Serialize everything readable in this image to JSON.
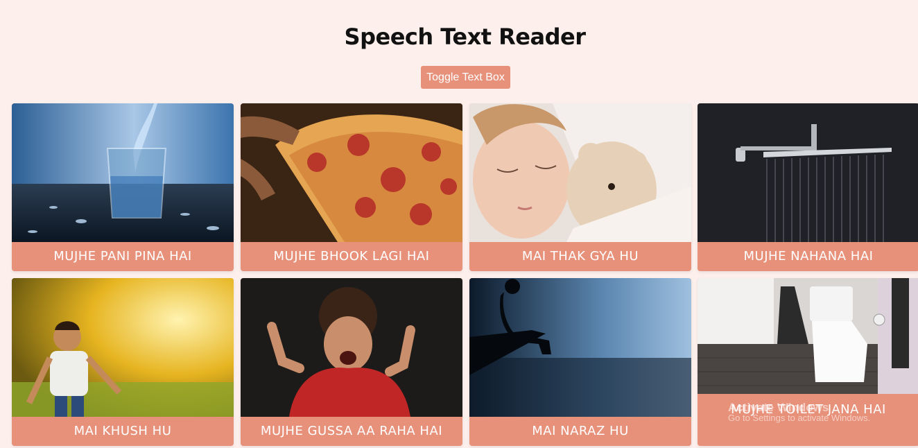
{
  "page": {
    "title": "Speech Text Reader"
  },
  "toolbar": {
    "toggle_label": "Toggle Text Box"
  },
  "cards": [
    {
      "label": "MUJHE PANI PINA HAI",
      "image": "glass-of-water-photo"
    },
    {
      "label": "MUJHE BHOOK LAGI HAI",
      "image": "pizza-photo"
    },
    {
      "label": "MAI THAK GYA HU",
      "image": "sleeping-child-photo"
    },
    {
      "label": "MUJHE NAHANA HAI",
      "image": "shower-photo"
    },
    {
      "label": "MAI KHUSH HU",
      "image": "happy-child-sprinkler-photo"
    },
    {
      "label": "MUJHE GUSSA AA RAHA HAI",
      "image": "angry-child-photo"
    },
    {
      "label": "MAI NARAZ HU",
      "image": "sad-person-silhouette-photo"
    },
    {
      "label": "MUJHE TOILET JANA HAI",
      "image": "toilet-photo"
    }
  ],
  "watermark": {
    "title": "Activate Windows",
    "subtitle": "Go to Settings to activate Windows."
  },
  "colors": {
    "background": "#fdefeb",
    "accent": "#e8917a"
  }
}
